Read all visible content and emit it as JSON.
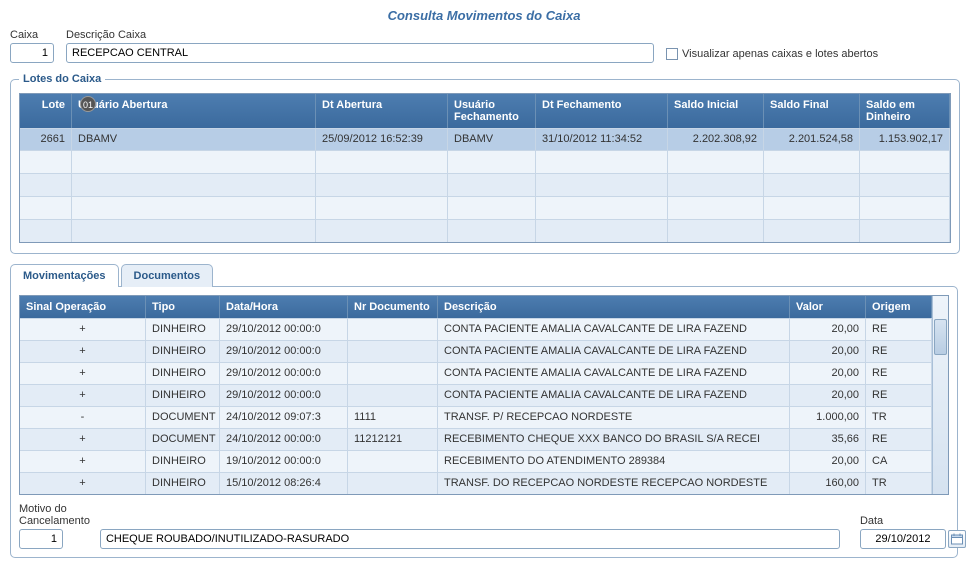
{
  "page_title": "Consulta Movimentos do Caixa",
  "labels": {
    "caixa": "Caixa",
    "descricao_caixa": "Descrição Caixa",
    "visualizar_abertos": "Visualizar apenas caixas e lotes abertos",
    "lotes_do_caixa": "Lotes do Caixa",
    "motivo_cancelamento": "Motivo do Cancelamento",
    "data": "Data"
  },
  "caixa": {
    "numero": "1",
    "descricao": "RECEPCAO CENTRAL"
  },
  "lotes_headers": {
    "lote": "Lote",
    "usuario_abertura": "Usuário Abertura",
    "dt_abertura": "Dt Abertura",
    "usuario_fechamento": "Usuário Fechamento",
    "dt_fechamento": "Dt Fechamento",
    "saldo_inicial": "Saldo Inicial",
    "saldo_final": "Saldo Final",
    "saldo_dinheiro": "Saldo em Dinheiro",
    "badge": "01"
  },
  "lotes_rows": [
    {
      "lote": "2661",
      "usuario_abertura": "DBAMV",
      "dt_abertura": "25/09/2012 16:52:39",
      "usuario_fechamento": "DBAMV",
      "dt_fechamento": "31/10/2012 11:34:52",
      "saldo_inicial": "2.202.308,92",
      "saldo_final": "2.201.524,58",
      "saldo_dinheiro": "1.153.902,17"
    }
  ],
  "tabs": {
    "movimentacoes": "Movimentações",
    "documentos": "Documentos"
  },
  "mov_headers": {
    "sinal": "Sinal Operação",
    "tipo": "Tipo",
    "data_hora": "Data/Hora",
    "nr_documento": "Nr Documento",
    "descricao": "Descrição",
    "valor": "Valor",
    "origem": "Origem"
  },
  "mov_rows": [
    {
      "sinal": "+",
      "tipo": "DINHEIRO",
      "data_hora": "29/10/2012 00:00:0",
      "nr_documento": "",
      "descricao": "CONTA PACIENTE AMALIA CAVALCANTE DE LIRA FAZEND",
      "valor": "20,00",
      "origem": "RE"
    },
    {
      "sinal": "+",
      "tipo": "DINHEIRO",
      "data_hora": "29/10/2012 00:00:0",
      "nr_documento": "",
      "descricao": "CONTA PACIENTE AMALIA CAVALCANTE DE LIRA FAZEND",
      "valor": "20,00",
      "origem": "RE"
    },
    {
      "sinal": "+",
      "tipo": "DINHEIRO",
      "data_hora": "29/10/2012 00:00:0",
      "nr_documento": "",
      "descricao": "CONTA PACIENTE AMALIA CAVALCANTE DE LIRA FAZEND",
      "valor": "20,00",
      "origem": "RE"
    },
    {
      "sinal": "+",
      "tipo": "DINHEIRO",
      "data_hora": "29/10/2012 00:00:0",
      "nr_documento": "",
      "descricao": "CONTA PACIENTE AMALIA CAVALCANTE DE LIRA FAZEND",
      "valor": "20,00",
      "origem": "RE"
    },
    {
      "sinal": "-",
      "tipo": "DOCUMENT",
      "data_hora": "24/10/2012 09:07:3",
      "nr_documento": "1111",
      "descricao": "TRANSF. P/ RECEPCAO NORDESTE",
      "valor": "1.000,00",
      "origem": "TR"
    },
    {
      "sinal": "+",
      "tipo": "DOCUMENT",
      "data_hora": "24/10/2012 00:00:0",
      "nr_documento": "11212121",
      "descricao": "RECEBIMENTO CHEQUE XXX  BANCO DO BRASIL S/A RECEI",
      "valor": "35,66",
      "origem": "RE"
    },
    {
      "sinal": "+",
      "tipo": "DINHEIRO",
      "data_hora": "19/10/2012 00:00:0",
      "nr_documento": "",
      "descricao": "RECEBIMENTO DO ATENDIMENTO 289384",
      "valor": "20,00",
      "origem": "CA"
    },
    {
      "sinal": "+",
      "tipo": "DINHEIRO",
      "data_hora": "15/10/2012 08:26:4",
      "nr_documento": "",
      "descricao": "TRANSF. DO RECEPCAO NORDESTE RECEPCAO NORDESTE",
      "valor": "160,00",
      "origem": "TR"
    }
  ],
  "motivo": {
    "numero": "1",
    "descricao": "CHEQUE ROUBADO/INUTILIZADO-RASURADO"
  },
  "data_valor": "29/10/2012"
}
